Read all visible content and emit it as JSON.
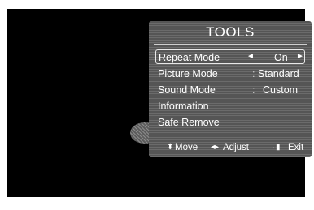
{
  "panel": {
    "title": "TOOLS",
    "items": [
      {
        "label": "Repeat Mode",
        "value": "On",
        "left_arrow": "◄",
        "right_arrow": "►"
      },
      {
        "label": "Picture Mode",
        "separator": ":",
        "value": "Standard"
      },
      {
        "label": "Sound Mode",
        "separator": ":",
        "value": "Custom"
      },
      {
        "label": "Information"
      },
      {
        "label": "Safe Remove"
      }
    ],
    "footer": {
      "move_icon": "⬍",
      "move_label": "Move",
      "adjust_icon": "◂▸",
      "adjust_label": "Adjust",
      "exit_icon": "→▮",
      "exit_label": "Exit"
    }
  }
}
